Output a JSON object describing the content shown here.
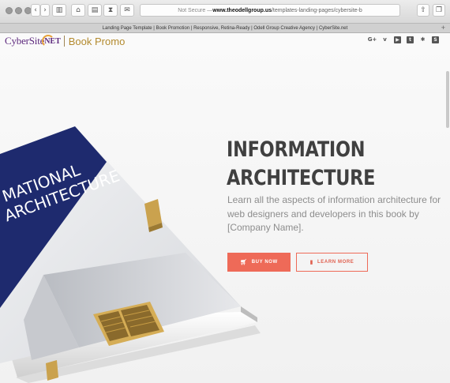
{
  "browser": {
    "address_prefix": "Not Secure — ",
    "address_host": "www.theodellgroup.us",
    "address_path": "/templates-landing-pages/cybersite-b",
    "tab_title": "Landing Page Template | Book Promotion | Responsive, Retina-Ready | Odell Group Creative Agency | CyberSite.net",
    "new_tab_symbol": "+"
  },
  "header": {
    "logo_text": "CyberSite",
    "logo_suffix": "NET",
    "logo_product": "Book Promo",
    "social": [
      {
        "icon": "google-plus-icon",
        "glyph": "G+"
      },
      {
        "icon": "vimeo-icon",
        "glyph": "v"
      },
      {
        "icon": "youtube-icon",
        "glyph": "▶"
      },
      {
        "icon": "tumblr-icon",
        "glyph": "t"
      },
      {
        "icon": "yelp-icon",
        "glyph": "✱"
      },
      {
        "icon": "skype-icon",
        "glyph": "S"
      }
    ]
  },
  "book": {
    "cover_lines": [
      "MATIONAL",
      "ARCHITECTURE"
    ]
  },
  "hero": {
    "headline_line1": "INFORMATION",
    "headline_line2": "ARCHITECTURE",
    "subtitle": "Learn all the aspects of information architecture for web designers and developers in this book by [Company Name].",
    "buy_label": "BUY NOW",
    "learn_label": "LEARN MORE"
  },
  "colors": {
    "accent": "#ee6a58",
    "headline": "#404040",
    "cover_navy": "#1e2a6e",
    "logo_purple": "#5e2a7e",
    "logo_gold": "#b38a2e"
  }
}
